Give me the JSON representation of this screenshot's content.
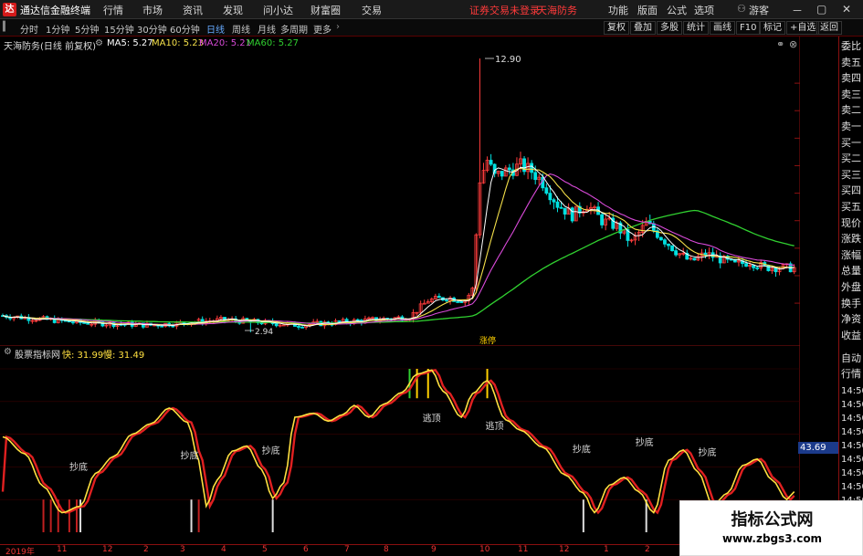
{
  "menubar": {
    "logo": "达",
    "app_title": "通达信金融终端",
    "menus": [
      "行情",
      "市场",
      "资讯",
      "发现",
      "问小达",
      "财富圈",
      "交易"
    ],
    "alert": "证券交易未登录",
    "stock_name": "天海防务",
    "right_menus": [
      "功能",
      "版面",
      "公式",
      "选项"
    ],
    "guest": "游客",
    "win_controls": [
      "－",
      "▢",
      "✕"
    ]
  },
  "periods": [
    "分时",
    "1分钟",
    "5分钟",
    "15分钟",
    "30分钟",
    "60分钟",
    "日线",
    "周线",
    "月线",
    "多周期",
    "更多"
  ],
  "active_period": "日线",
  "toolbar_right": [
    "复权",
    "叠加",
    "多股",
    "统计",
    "画线",
    "F10",
    "标记",
    "+自选",
    "返回"
  ],
  "main_chart": {
    "title": "天海防务(日线 前复权)",
    "ma": [
      {
        "label": "MA5: 5.27",
        "color": "#ffffff"
      },
      {
        "label": "MA10: 5.23",
        "color": "#f5e14a"
      },
      {
        "label": "MA20: 5.21",
        "color": "#d94ad9"
      },
      {
        "label": "MA60: 5.27",
        "color": "#30d030"
      }
    ],
    "y_ticks": [
      "12.00",
      "11.00",
      "10.00",
      "9.00",
      "8.00",
      "7.00",
      "6.00",
      "5.00",
      "4.00"
    ],
    "high_label": "12.90",
    "low_label": "2.94",
    "vol_tag": "涨停",
    "close_ref": "5.27"
  },
  "indicator_chart": {
    "name": "股票指标网",
    "fast_label": "快: 31.99",
    "slow_label": "慢: 31.49",
    "y_ticks": [
      "100.00",
      "80.00",
      "60.00",
      "40.00",
      "20.00"
    ],
    "current_value": "43.69",
    "buy_labels": [
      "抄底",
      "抄底",
      "抄底",
      "抄底",
      "抄底",
      "抄底"
    ],
    "escape_labels": [
      "逃顶",
      "逃顶"
    ]
  },
  "date_axis": [
    "2019年",
    "11",
    "12",
    "2",
    "3",
    "4",
    "5",
    "6",
    "7",
    "8",
    "9",
    "10",
    "11",
    "12",
    "1",
    "2"
  ],
  "sidebar": {
    "items": [
      "委比",
      "卖五",
      "卖四",
      "卖三",
      "卖二",
      "卖一",
      "买一",
      "买二",
      "买三",
      "买四",
      "买五",
      "现价",
      "涨跌",
      "涨幅",
      "总量",
      "外盘",
      "换手",
      "净资",
      "收益"
    ],
    "items2": [
      "自动",
      "行情"
    ],
    "times": [
      "14:50",
      "14:50",
      "14:50",
      "14:50",
      "14:50",
      "14:50",
      "14:50",
      "14:50",
      "14:50",
      "14:50",
      "14:50",
      "14:50"
    ]
  },
  "watermark": {
    "title": "指标公式网",
    "url": "www.zbgs3.com"
  },
  "colors": {
    "up": "#ff3c3c",
    "down": "#00e0e0",
    "fast": "#ffe040",
    "slow": "#e02020",
    "ma60": "#30d030",
    "ma20": "#d94ad9"
  },
  "chart_data": {
    "type": "line",
    "series": [
      {
        "name": "MA5",
        "values": []
      },
      {
        "name": "MA10",
        "values": []
      },
      {
        "name": "MA20",
        "values": []
      },
      {
        "name": "MA60",
        "values": []
      }
    ],
    "ylim": [
      3.0,
      13.0
    ],
    "indicator_ylim": [
      0,
      100
    ]
  }
}
